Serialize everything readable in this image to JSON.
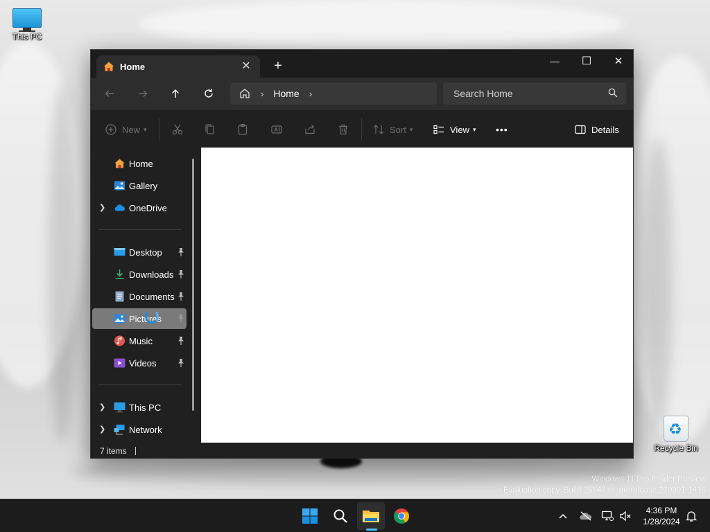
{
  "desktop": {
    "icons": [
      {
        "label": "This PC"
      },
      {
        "label": "Recycle Bin"
      }
    ],
    "watermark": {
      "line1": "Windows 11 Pro Insider Preview",
      "line2": "Evaluation copy. Build 25947.rs_prerelease.230901-1416"
    }
  },
  "window": {
    "tab": {
      "label": "Home",
      "close": "✕"
    },
    "new_tab": "+",
    "controls": {
      "minimize": "—",
      "maximize": "☐",
      "close": "✕"
    },
    "address": {
      "crumb": "Home"
    },
    "search": {
      "placeholder": "Search Home"
    },
    "toolbar": {
      "new_label": "New",
      "sort_label": "Sort",
      "view_label": "View",
      "more_label": "•••",
      "details_label": "Details"
    },
    "nav_pane": {
      "items": [
        {
          "label": "Home",
          "icon": "home-icon"
        },
        {
          "label": "Gallery",
          "icon": "gallery-icon"
        },
        {
          "label": "OneDrive",
          "icon": "onedrive-icon"
        },
        {
          "label": "Desktop",
          "icon": "desktop-icon",
          "pinned": true
        },
        {
          "label": "Downloads",
          "icon": "downloads-icon",
          "pinned": true
        },
        {
          "label": "Documents",
          "icon": "documents-icon",
          "pinned": true
        },
        {
          "label": "Pictures",
          "icon": "pictures-icon",
          "pinned": true,
          "selected": true
        },
        {
          "label": "Music",
          "icon": "music-icon",
          "pinned": true
        },
        {
          "label": "Videos",
          "icon": "videos-icon",
          "pinned": true
        },
        {
          "label": "This PC",
          "icon": "this-pc-icon"
        },
        {
          "label": "Network",
          "icon": "network-icon"
        }
      ]
    },
    "status": {
      "items_count": "7 items"
    }
  },
  "taskbar": {
    "clock": {
      "time": "4:36 PM",
      "date": "1/28/2024"
    },
    "colors": {
      "accent": "#4cc2ff",
      "background": "#1c1c1c"
    }
  }
}
